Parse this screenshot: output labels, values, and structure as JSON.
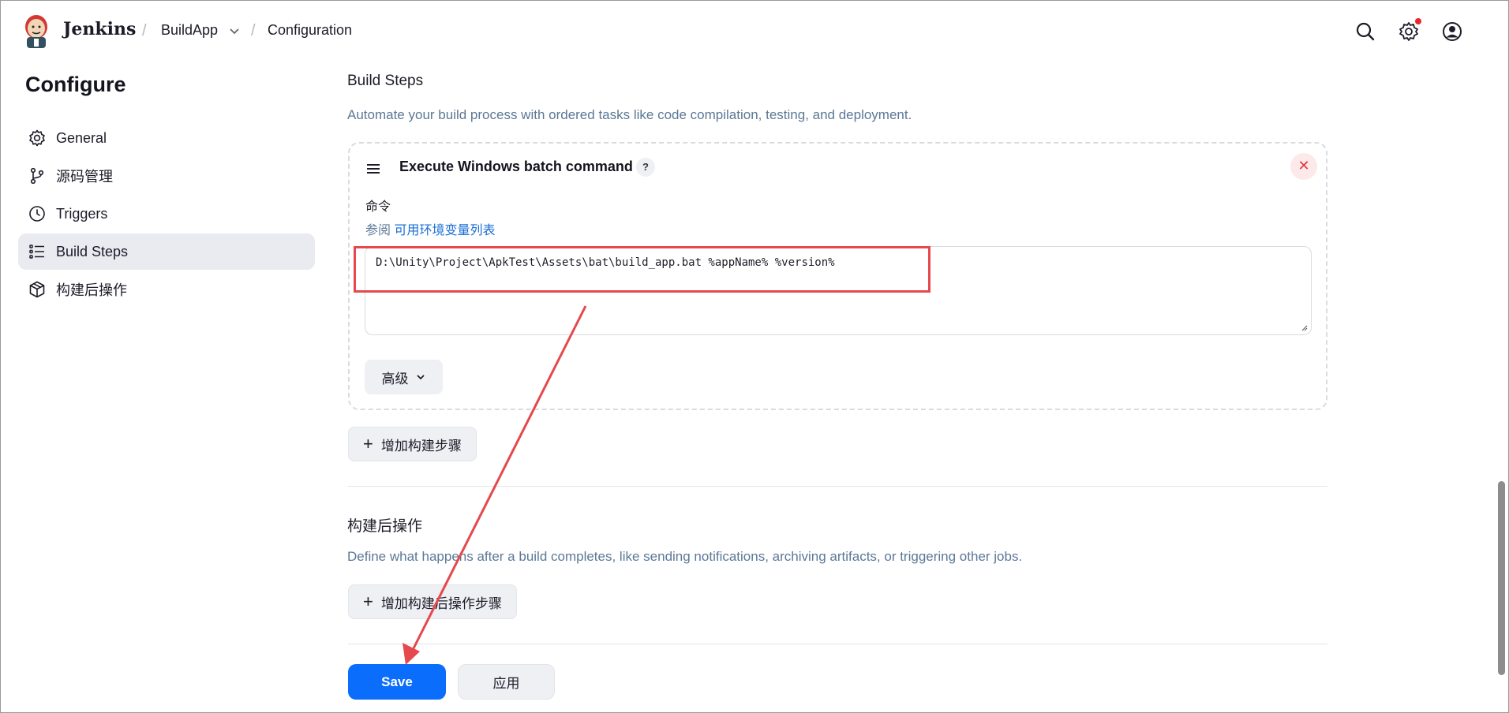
{
  "header": {
    "brand": "Jenkins",
    "breadcrumb": [
      "BuildApp",
      "Configuration"
    ],
    "icons": [
      "search-icon",
      "gear-icon",
      "user-icon"
    ],
    "notification_color": "#e8262d"
  },
  "sidebar": {
    "title": "Configure",
    "items": [
      {
        "label": "General",
        "icon": "gear-icon"
      },
      {
        "label": "源码管理",
        "icon": "git-branch-icon"
      },
      {
        "label": "Triggers",
        "icon": "clock-icon"
      },
      {
        "label": "Build Steps",
        "icon": "list-icon",
        "active": true
      },
      {
        "label": "构建后操作",
        "icon": "package-icon"
      }
    ]
  },
  "build_steps": {
    "title": "Build Steps",
    "description": "Automate your build process with ordered tasks like code compilation, testing, and deployment.",
    "step": {
      "title": "Execute Windows batch command",
      "help": "?",
      "delete": "✕",
      "field_label": "命令",
      "hint_prefix": "参阅",
      "hint_link": "可用环境变量列表",
      "command": "D:\\Unity\\Project\\ApkTest\\Assets\\bat\\build_app.bat %appName% %version%",
      "advanced": "高级"
    },
    "add_button": "增加构建步骤"
  },
  "post_build": {
    "title": "构建后操作",
    "description": "Define what happens after a build completes, like sending notifications, archiving artifacts, or triggering other jobs.",
    "add_button": "增加构建后操作步骤"
  },
  "actions": {
    "save": "Save",
    "apply": "应用"
  },
  "colors": {
    "primary": "#0b6dfb",
    "annotation": "#e5484d",
    "link": "#1a6fd6",
    "description": "#5c7896"
  }
}
